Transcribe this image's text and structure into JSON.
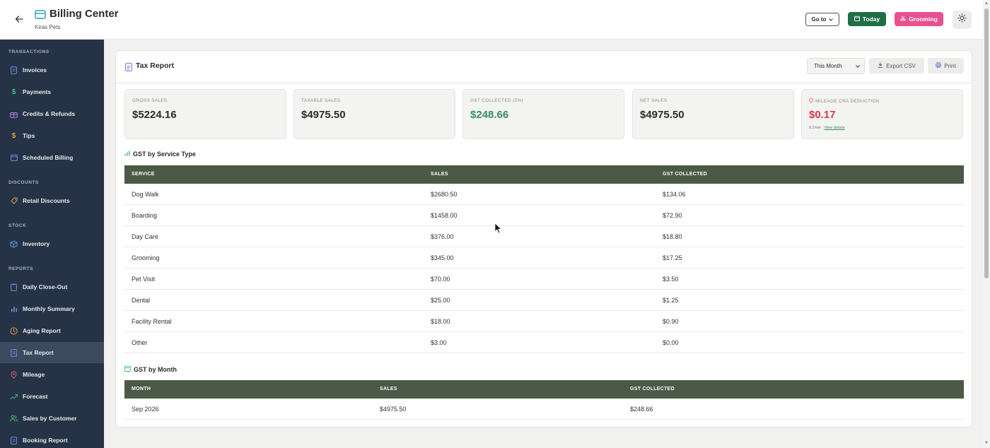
{
  "header": {
    "title": "Billing Center",
    "subtitle": "Kiras Pets",
    "goto_label": "Go to",
    "today_label": "Today",
    "grooming_label": "Grooming"
  },
  "sidebar": {
    "sections": {
      "transactions": "TRANSACTIONS",
      "discounts": "DISCOUNTS",
      "stock": "STOCK",
      "reports": "REPORTS"
    },
    "items": [
      {
        "label": "Invoices",
        "icon": "document-icon"
      },
      {
        "label": "Payments",
        "icon": "dollar-icon"
      },
      {
        "label": "Credits & Refunds",
        "icon": "gift-icon"
      },
      {
        "label": "Tips",
        "icon": "dollar-icon"
      },
      {
        "label": "Scheduled Billing",
        "icon": "calendar-icon"
      },
      {
        "label": "Retail Discounts",
        "icon": "tag-icon"
      },
      {
        "label": "Inventory",
        "icon": "box-icon"
      },
      {
        "label": "Daily Close-Out",
        "icon": "clipboard-icon"
      },
      {
        "label": "Monthly Summary",
        "icon": "bar-chart-icon"
      },
      {
        "label": "Aging Report",
        "icon": "clock-icon"
      },
      {
        "label": "Tax Report",
        "icon": "document-icon",
        "active": true
      },
      {
        "label": "Mileage",
        "icon": "map-pin-icon"
      },
      {
        "label": "Forecast",
        "icon": "trend-icon"
      },
      {
        "label": "Sales by Customer",
        "icon": "users-icon"
      },
      {
        "label": "Booking Report",
        "icon": "document-icon"
      }
    ]
  },
  "report": {
    "title": "Tax Report",
    "period": "This Month",
    "export_label": "Export CSV",
    "print_label": "Print"
  },
  "stats": {
    "gross": {
      "label": "GROSS SALES",
      "value": "$5224.16"
    },
    "taxable": {
      "label": "TAXABLE SALES",
      "value": "$4975.50"
    },
    "gst": {
      "label": "GST COLLECTED (5%)",
      "value": "$248.66"
    },
    "net": {
      "label": "NET SALES",
      "value": "$4975.50"
    },
    "mileage": {
      "label": "MILEAGE CRA DEDUCTION",
      "value": "$0.17",
      "note": "0.3 km · ",
      "link": "View details"
    }
  },
  "service_table": {
    "title": "GST by Service Type",
    "headers": [
      "SERVICE",
      "SALES",
      "GST COLLECTED"
    ],
    "rows": [
      [
        "Dog Walk",
        "$2680.50",
        "$134.06"
      ],
      [
        "Boarding",
        "$1458.00",
        "$72.90"
      ],
      [
        "Day Care",
        "$376.00",
        "$18.80"
      ],
      [
        "Grooming",
        "$345.00",
        "$17.25"
      ],
      [
        "Pet Visit",
        "$70.00",
        "$3.50"
      ],
      [
        "Dental",
        "$25.00",
        "$1.25"
      ],
      [
        "Facility Rental",
        "$18.00",
        "$0.90"
      ],
      [
        "Other",
        "$3.00",
        "$0.00"
      ]
    ]
  },
  "month_table": {
    "title": "GST by Month",
    "headers": [
      "MONTH",
      "SALES",
      "GST COLLECTED"
    ],
    "rows": [
      [
        "Sep 2026",
        "$4975.50",
        "$248.66"
      ]
    ]
  },
  "colors": {
    "sidebar_bg": "#263346",
    "table_header": "#4a5a46",
    "today_green": "#1f6e46",
    "grooming_pink": "#e8508f",
    "gst_green": "#3a8a6a",
    "mileage_red": "#d8384e"
  }
}
